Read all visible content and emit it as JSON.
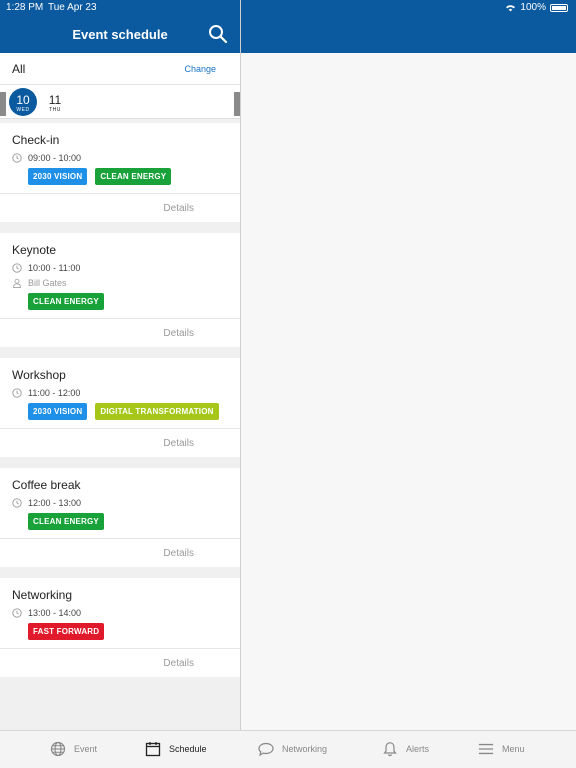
{
  "status": {
    "time": "1:28 PM",
    "date": "Tue Apr 23",
    "battery": "100%"
  },
  "header": {
    "title": "Event schedule"
  },
  "filter": {
    "label": "All",
    "change": "Change"
  },
  "days": [
    {
      "num": "10",
      "dow": "WED",
      "selected": true
    },
    {
      "num": "11",
      "dow": "THU",
      "selected": false
    }
  ],
  "colors": {
    "brand": "#0b5a9f",
    "tag_vision": "#1e90e8",
    "tag_energy": "#1aa23a",
    "tag_digital": "#a6c71a",
    "tag_fast": "#e0192b"
  },
  "sessions": [
    {
      "title": "Check-in",
      "time": "09:00 - 10:00",
      "speaker": "",
      "tags": [
        "2030 VISION",
        "CLEAN ENERGY"
      ],
      "details": "Details"
    },
    {
      "title": "Keynote",
      "time": "10:00 - 11:00",
      "speaker": "Bill Gates",
      "tags": [
        "CLEAN ENERGY"
      ],
      "details": "Details"
    },
    {
      "title": "Workshop",
      "time": "11:00 - 12:00",
      "speaker": "",
      "tags": [
        "2030 VISION",
        "DIGITAL TRANSFORMATION"
      ],
      "details": "Details"
    },
    {
      "title": "Coffee break",
      "time": "12:00 - 13:00",
      "speaker": "",
      "tags": [
        "CLEAN ENERGY"
      ],
      "details": "Details"
    },
    {
      "title": "Networking",
      "time": "13:00 - 14:00",
      "speaker": "",
      "tags": [
        "FAST FORWARD"
      ],
      "details": "Details"
    }
  ],
  "tabs": [
    {
      "label": "Event",
      "icon": "globe-icon"
    },
    {
      "label": "Schedule",
      "icon": "calendar-icon"
    },
    {
      "label": "Networking",
      "icon": "chat-bubble-icon"
    },
    {
      "label": "Alerts",
      "icon": "bell-icon"
    },
    {
      "label": "Menu",
      "icon": "hamburger-icon"
    }
  ]
}
